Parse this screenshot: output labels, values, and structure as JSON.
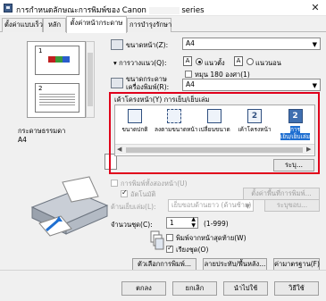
{
  "window": {
    "title": "การกำหนดลักษณะการพิมพ์ของ Canon",
    "title_suffix": "series",
    "close_glyph": "✕"
  },
  "tabs": [
    {
      "label": "ตั้งค่าแบบเร็ว"
    },
    {
      "label": "หลัก"
    },
    {
      "label": "ตั้งค่าหน้ากระดาษ"
    },
    {
      "label": "การบำรุงรักษา"
    }
  ],
  "preview": {
    "pages": [
      "1",
      "2"
    ]
  },
  "media": {
    "label": "กระดาษธรรมดา",
    "value": "A4"
  },
  "page_setup": {
    "page_size_label": "ขนาดหน้า(Z):",
    "page_size_value": "A4",
    "orientation_label": "การวางแนว(Q):",
    "portrait_label": "แนวตั้ง",
    "landscape_label": "แนวนอน",
    "portrait_glyph": "A",
    "landscape_glyph": "A",
    "rotate_label": "หมุน 180 องศา(1)",
    "output_size_label": "ขนาดกระดาษเครื่องพิมพ์(R):",
    "output_size_value": "A4"
  },
  "layout": {
    "label": "เค้าโครงหน้า(Y) การเย็บ/เย็บเล่ม",
    "items": [
      {
        "label": "ขนาดปกติ",
        "glyph": ""
      },
      {
        "label": "ลงตามขนาดหน้า",
        "glyph": ""
      },
      {
        "label": "เปลี่ยนขนาด",
        "glyph": ""
      },
      {
        "label": "เค้าโครงหน้า",
        "glyph": "2"
      },
      {
        "label": "การ",
        "label2": "เย็บ/เย็บเล่ม",
        "glyph": "2"
      }
    ],
    "specify_button": "ระบุ..."
  },
  "stapling": {
    "auto_duplex_label": "การพิมพ์ทั้งสองหน้า(U)",
    "auto_label": "อัตโนมัติ",
    "duplex_area_button": "ตั้งค่าพื้นที่การพิมพ์...",
    "stapling_side_label": "ด้านเย็บเล่ม(L):",
    "stapling_side_value": "เย็บขอบด้านยาว (ด้านซ้าย)",
    "margin_button": "ระบุขอบ..."
  },
  "copies": {
    "label": "จำนวนชุด(C):",
    "value": "1",
    "range": "(1-999)",
    "last_page_label": "พิมพ์จากหน้าสุดท้าย(W)",
    "collate_label": "เรียงชุด(O)"
  },
  "bottom_buttons": {
    "print_options": "ตัวเลือกการพิมพ์...",
    "stamp_background": "ลายประทับ/พื้นหลัง...",
    "defaults": "ค่ามาตรฐาน(F)"
  },
  "dialog_buttons": {
    "ok": "ตกลง",
    "cancel": "ยกเลิก",
    "apply": "นำไปใช้",
    "help": "วิธีใช้"
  }
}
